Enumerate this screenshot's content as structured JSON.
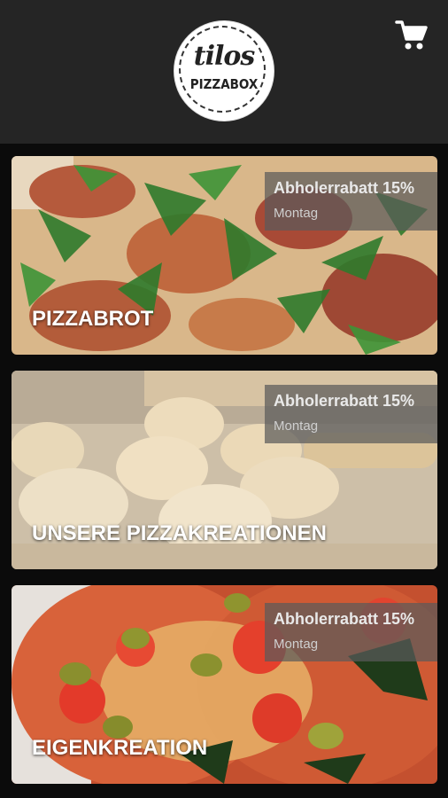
{
  "brand": {
    "logo_script": "tilos",
    "logo_sub": "PIZZABOX"
  },
  "header": {
    "cart_icon": "shopping-cart-icon"
  },
  "categories": [
    {
      "title": "PIZZABROT",
      "badge_title": "Abholerrabatt 15%",
      "badge_sub": "Montag"
    },
    {
      "title": "UNSERE PIZZAKREATIONEN",
      "badge_title": "Abholerrabatt 15%",
      "badge_sub": "Montag"
    },
    {
      "title": "EIGENKREATION",
      "badge_title": "Abholerrabatt 15%",
      "badge_sub": "Montag"
    }
  ],
  "colors": {
    "header_bg": "#252525",
    "page_bg": "#0b0b0b",
    "badge_bg": "#5a5a5a"
  }
}
